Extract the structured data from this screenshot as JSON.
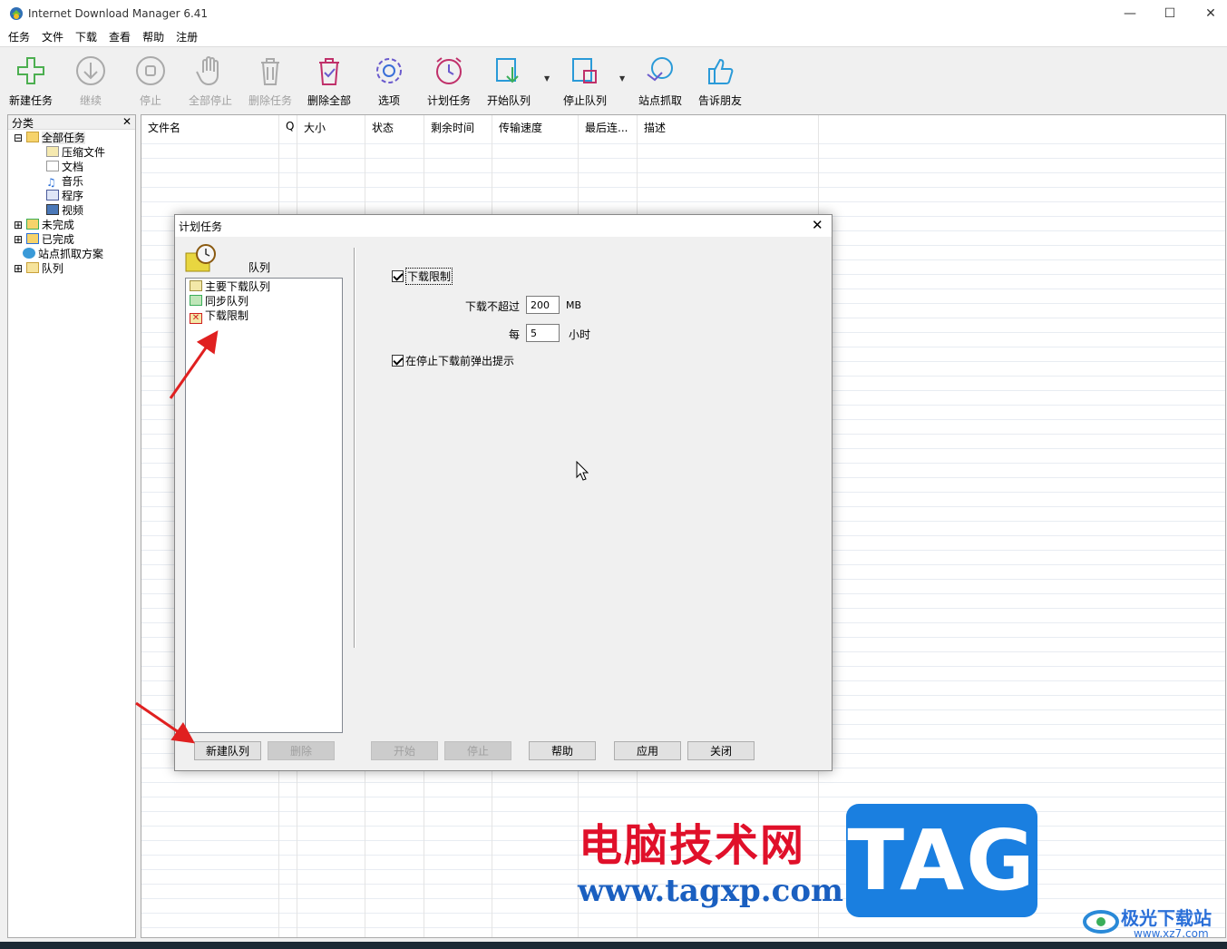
{
  "window": {
    "title": "Internet Download Manager 6.41",
    "min": "—",
    "max": "☐",
    "close": "✕"
  },
  "menu": [
    "任务",
    "文件",
    "下载",
    "查看",
    "帮助",
    "注册"
  ],
  "toolbar": {
    "new_task": "新建任务",
    "resume": "继续",
    "stop": "停止",
    "stop_all": "全部停止",
    "delete_task": "删除任务",
    "delete_all": "删除全部",
    "options": "选项",
    "scheduler": "计划任务",
    "start_queue": "开始队列",
    "stop_queue": "停止队列",
    "grabber": "站点抓取",
    "tell_friend": "告诉朋友"
  },
  "categories": {
    "header": "分类",
    "close": "✕",
    "all": "全部任务",
    "compressed": "压缩文件",
    "documents": "文档",
    "music": "音乐",
    "programs": "程序",
    "video": "视频",
    "unfinished": "未完成",
    "finished": "已完成",
    "grabber_projects": "站点抓取方案",
    "queues": "队列"
  },
  "columns": [
    "文件名",
    "Q",
    "大小",
    "状态",
    "剩余时间",
    "传输速度",
    "最后连...",
    "描述"
  ],
  "dialog": {
    "title": "计划任务",
    "close": "✕",
    "queues_label": "队列",
    "queues": [
      "主要下载队列",
      "同步队列",
      "下载限制"
    ],
    "limit_checkbox": "下载限制",
    "no_more_than": "下载不超过",
    "limit_value": "200",
    "unit_mb": "MB",
    "every": "每",
    "every_value": "5",
    "unit_hours": "小时",
    "prompt_checkbox": "在停止下载前弹出提示",
    "buttons": {
      "new_queue": "新建队列",
      "delete": "删除",
      "start": "开始",
      "stop": "停止",
      "help": "帮助",
      "apply": "应用",
      "close": "关闭"
    }
  },
  "watermark": {
    "site_cn": "电脑技术网",
    "site_url": "www.tagxp.com",
    "tag": "TAG",
    "brand2": "极光下载站",
    "brand2_url": "www.xz7.com"
  },
  "colors": {
    "red_arrow": "#e02020",
    "tag_blue": "#1a7fe0",
    "wm_red": "#e0102a"
  }
}
